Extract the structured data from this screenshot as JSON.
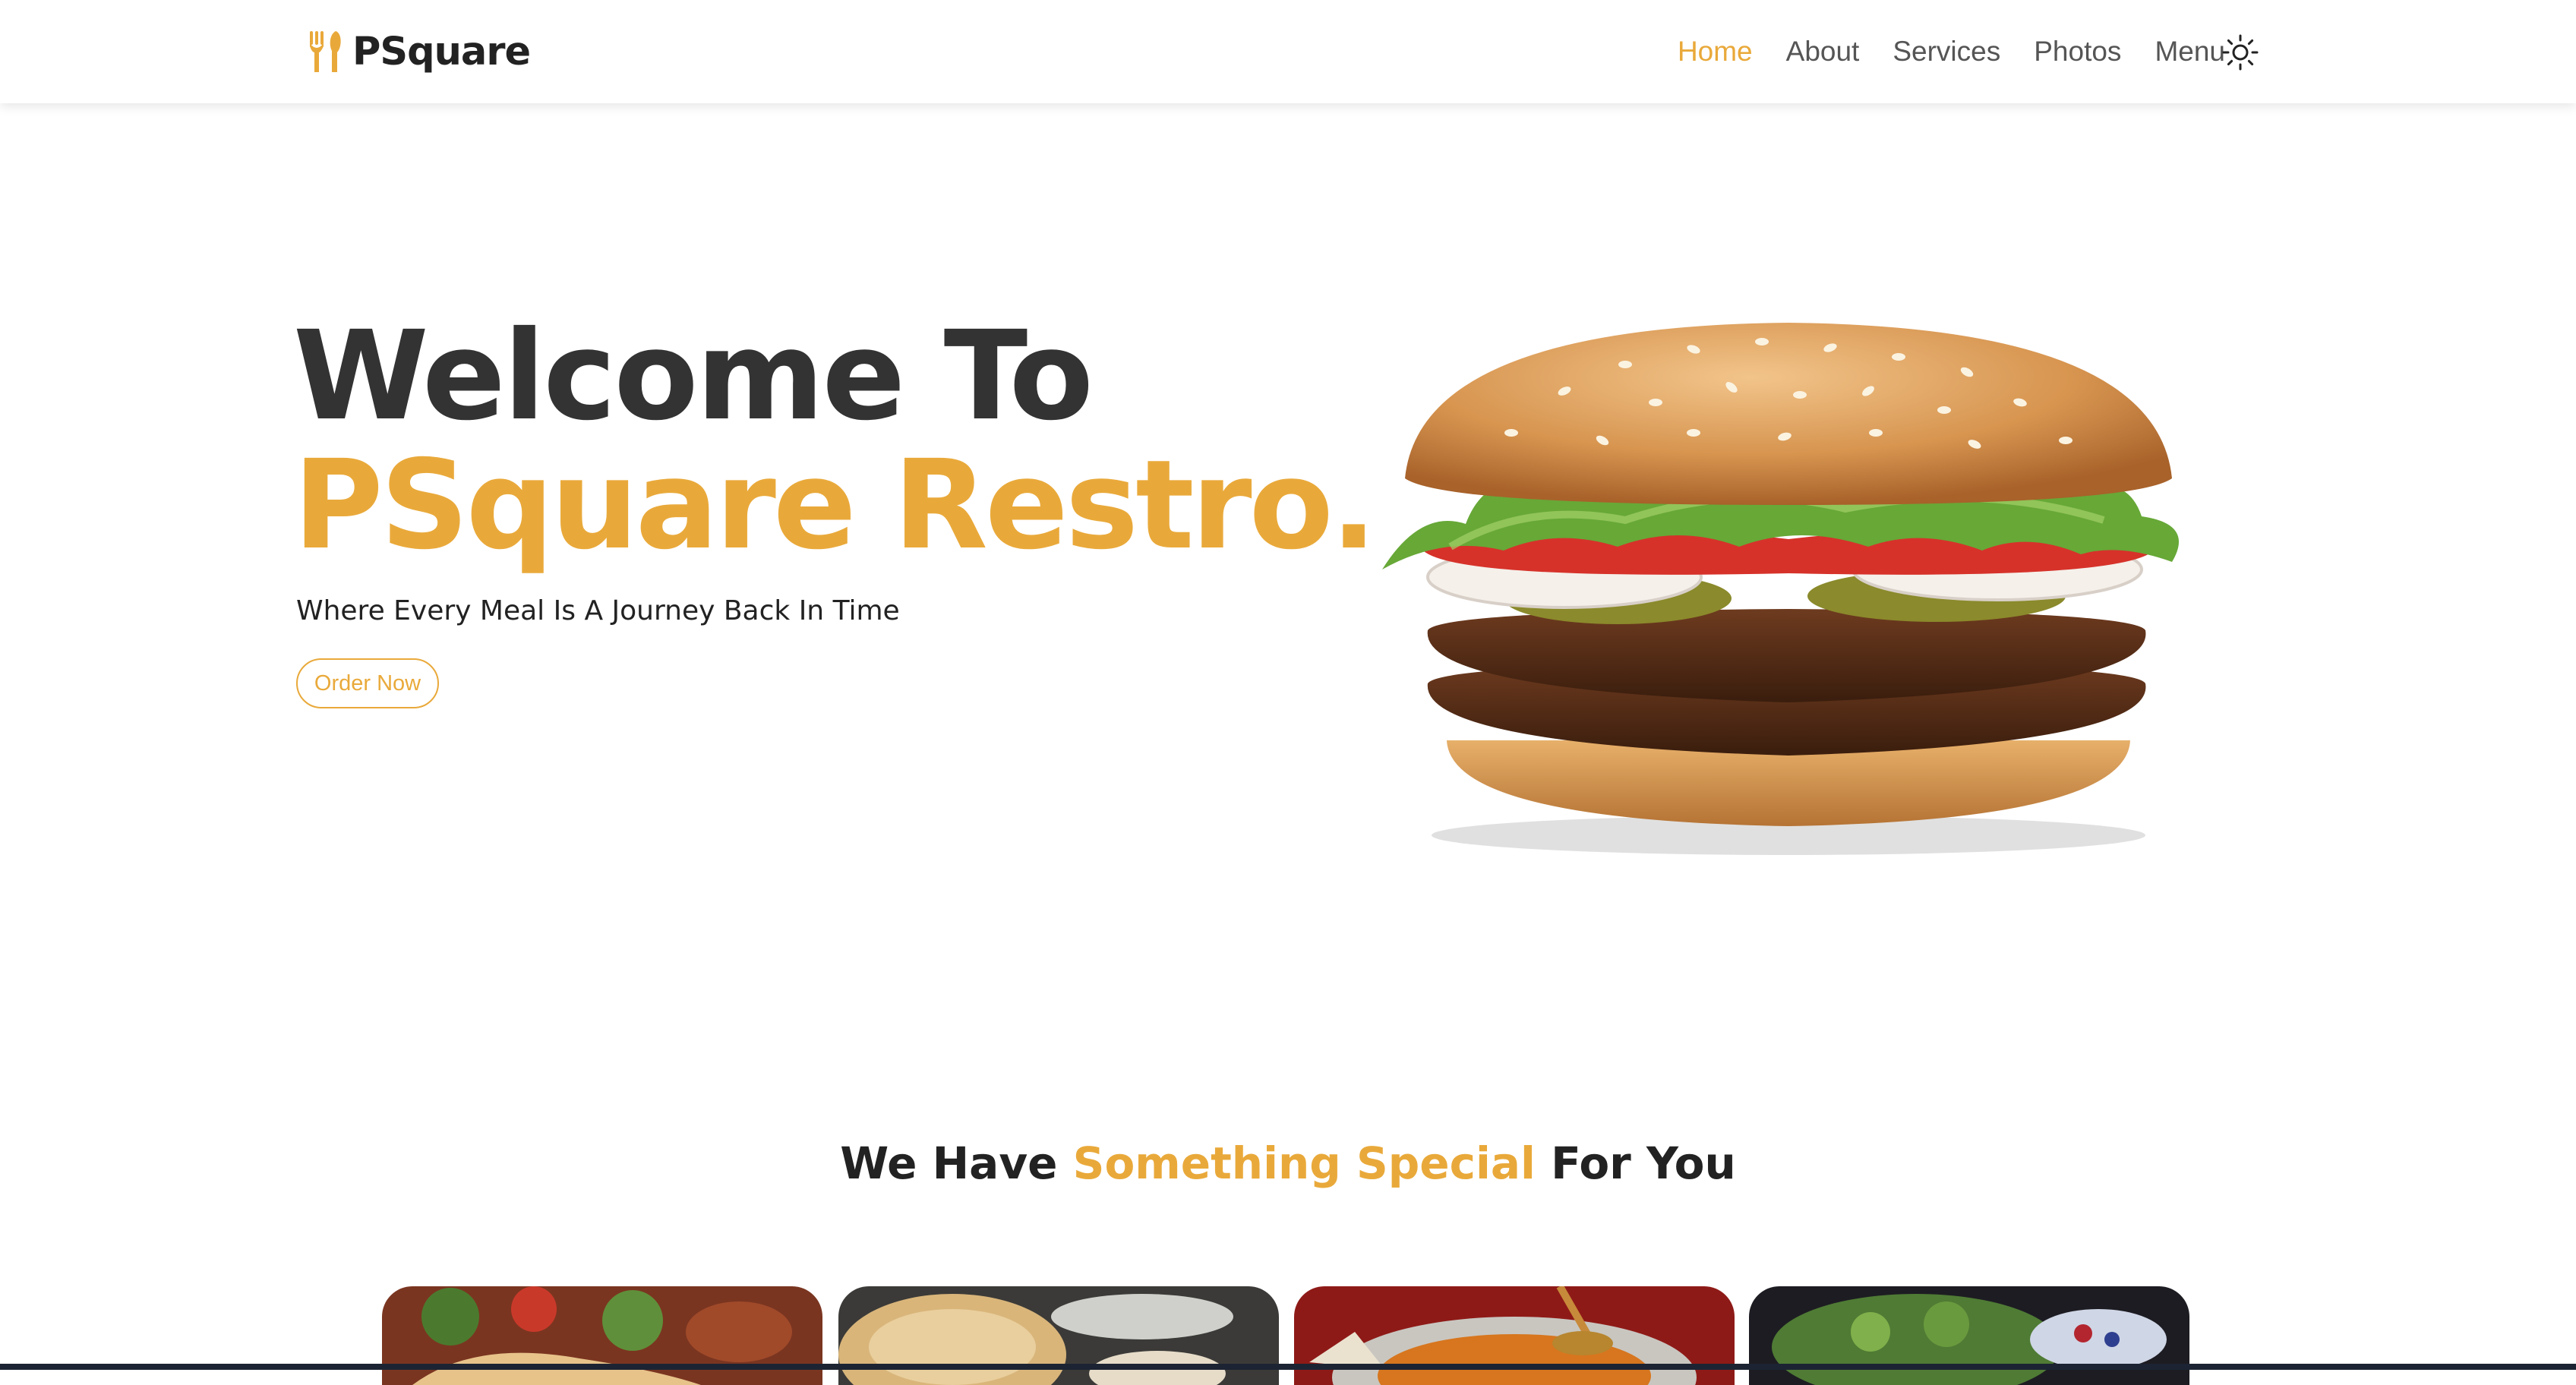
{
  "navbar": {
    "brand_name": "PSquare",
    "brand_icon": "fork-spoon-icon",
    "links": [
      {
        "label": "Home",
        "active": true
      },
      {
        "label": "About",
        "active": false
      },
      {
        "label": "Services",
        "active": false
      },
      {
        "label": "Photos",
        "active": false
      },
      {
        "label": "Menu",
        "active": false
      }
    ],
    "theme_toggle_icon": "sun-icon"
  },
  "hero": {
    "title_line1": "Welcome To",
    "title_line2": "PSquare Restro.",
    "tagline": "Where Every Meal Is A Journey Back In Time",
    "cta_label": "Order Now",
    "image": "burger-image"
  },
  "special": {
    "heading_prefix": "We Have ",
    "heading_highlight": "Something Special",
    "heading_suffix": " For You",
    "cards": [
      {
        "image": "wrap-dish-image"
      },
      {
        "image": "dumplings-image"
      },
      {
        "image": "curry-dish-image"
      },
      {
        "image": "salad-image"
      }
    ]
  },
  "colors": {
    "accent": "#e9a93a",
    "text_dark": "#333333",
    "nav_text": "#555555",
    "background": "#ffffff"
  }
}
